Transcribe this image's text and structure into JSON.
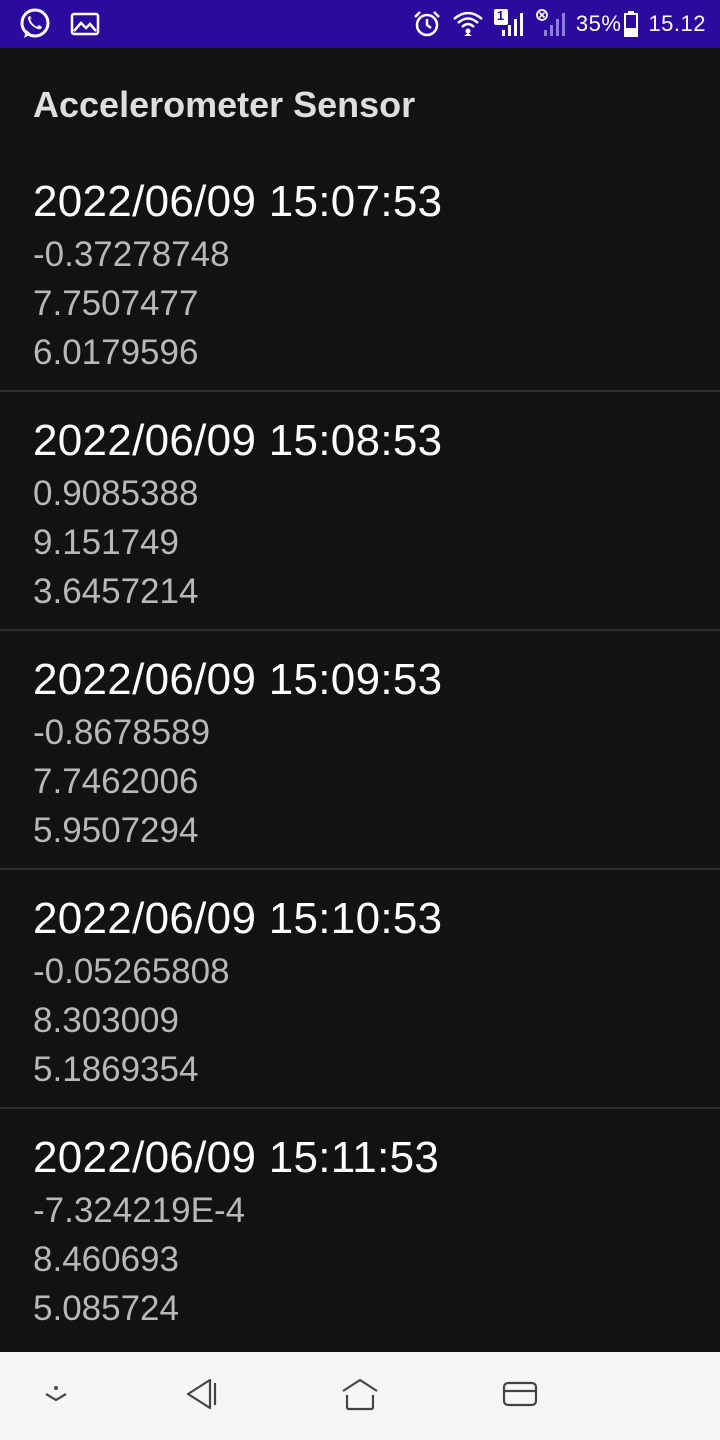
{
  "status_bar": {
    "battery": "35%",
    "time": "15.12",
    "sim_badge": "1",
    "icons": [
      "whatsapp-icon",
      "gallery-icon",
      "alarm-icon",
      "wifi-icon",
      "signal-sim1-icon",
      "signal-sim2-disabled-icon",
      "battery-icon"
    ],
    "background": "#2d0a9e"
  },
  "app": {
    "title": "Accelerometer Sensor"
  },
  "readings": [
    {
      "timestamp": "2022/06/09 15:07:53",
      "x": "-0.37278748",
      "y": "7.7507477",
      "z": "6.0179596"
    },
    {
      "timestamp": "2022/06/09 15:08:53",
      "x": "0.9085388",
      "y": "9.151749",
      "z": "3.6457214"
    },
    {
      "timestamp": "2022/06/09 15:09:53",
      "x": "-0.8678589",
      "y": "7.7462006",
      "z": "5.9507294"
    },
    {
      "timestamp": "2022/06/09 15:10:53",
      "x": "-0.05265808",
      "y": "8.303009",
      "z": "5.1869354"
    },
    {
      "timestamp": "2022/06/09 15:11:53",
      "x": "-7.324219E-4",
      "y": "8.460693",
      "z": "5.085724"
    }
  ],
  "nav_bar": {
    "icons": [
      "hide-nav-icon",
      "back-icon",
      "home-icon",
      "recents-icon"
    ]
  }
}
